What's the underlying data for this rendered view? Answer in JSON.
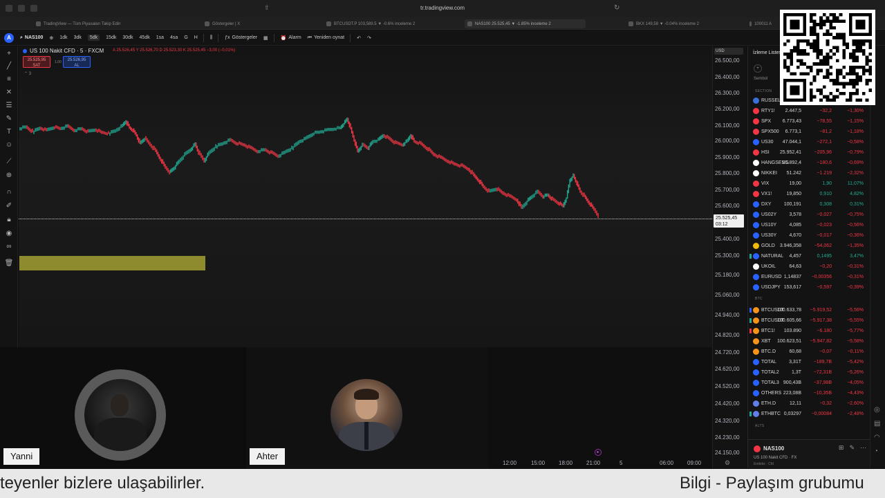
{
  "browser": {
    "url": "tr.tradingview.com",
    "tabs": [
      {
        "label": "TradingView — Tüm Piyasaları Takip Edin",
        "active": false
      },
      {
        "label": "Göstergeler | X",
        "active": false
      },
      {
        "label": "BTCUSDT.P 103,589.5 ▼ -0.6% inceleme 2",
        "active": false
      },
      {
        "label": "NAS100 25.525,45 ▼ -1.85% inceleme 2",
        "active": true
      },
      {
        "label": "BKX 149,58 ▼ -0.04% inceleme 2",
        "active": false
      },
      {
        "label": "100011 A",
        "active": false
      }
    ]
  },
  "toolbar": {
    "logo": "A",
    "symbol": "NAS100",
    "intervals": [
      "1dk",
      "3dk",
      "5dk",
      "15dk",
      "30dk",
      "45dk",
      "1sa",
      "4sa",
      "G",
      "H"
    ],
    "selected_interval": "5dk",
    "indicators_label": "Göstergeler",
    "alert_label": "Alarm",
    "replay_label": "Yeniden oynat"
  },
  "chart": {
    "legend_title": "US 100 Nakit CFD · 5 · FXCM",
    "legend_ohlc": "A 25.526,45  Y 25.526,70  D 25.523,30  K 25.525,45  −3,00 (−0,01%)",
    "sell_price": "25.525,95",
    "sell_label": "SAT",
    "buy_price": "25.526,95",
    "buy_label": "AL",
    "spread": "1,00",
    "legend_toggle": "⌃ 3",
    "currency": "USD",
    "current_price": "25.525,45",
    "countdown": "03:12",
    "price_ticks": [
      "26.500,00",
      "26.400,00",
      "26.300,00",
      "26.200,00",
      "26.100,00",
      "26.000,00",
      "25.900,00",
      "25.800,00",
      "25.700,00",
      "25.600,00",
      "25.400,00",
      "25.300,00",
      "25.180,00",
      "25.060,00",
      "24.940,00",
      "24.820,00",
      "24.720,00",
      "24.620,00",
      "24.520,00",
      "24.420,00",
      "24.320,00",
      "24.230,00",
      "24.150,00"
    ],
    "time_ticks": [
      "12:00",
      "15:00",
      "18:00",
      "21:00",
      "5",
      "06:00",
      "09:00"
    ],
    "series": [
      {
        "i": 0,
        "p": 26080
      },
      {
        "i": 10,
        "p": 26090
      },
      {
        "i": 20,
        "p": 26060
      },
      {
        "i": 30,
        "p": 26085
      },
      {
        "i": 40,
        "p": 26070
      },
      {
        "i": 50,
        "p": 26090
      },
      {
        "i": 60,
        "p": 26080
      },
      {
        "i": 70,
        "p": 26095
      },
      {
        "i": 80,
        "p": 26070
      },
      {
        "i": 90,
        "p": 26080
      },
      {
        "i": 100,
        "p": 26060
      },
      {
        "i": 110,
        "p": 26075
      },
      {
        "i": 120,
        "p": 26055
      },
      {
        "i": 130,
        "p": 26050
      },
      {
        "i": 140,
        "p": 26070
      },
      {
        "i": 150,
        "p": 26100
      },
      {
        "i": 155,
        "p": 26125
      },
      {
        "i": 160,
        "p": 26085
      },
      {
        "i": 165,
        "p": 26070
      },
      {
        "i": 170,
        "p": 26040
      },
      {
        "i": 175,
        "p": 25990
      },
      {
        "i": 182,
        "p": 26020
      },
      {
        "i": 190,
        "p": 25980
      },
      {
        "i": 198,
        "p": 25940
      },
      {
        "i": 205,
        "p": 25890
      },
      {
        "i": 212,
        "p": 25840
      },
      {
        "i": 218,
        "p": 25810
      },
      {
        "i": 225,
        "p": 25840
      },
      {
        "i": 232,
        "p": 25880
      },
      {
        "i": 240,
        "p": 25920
      },
      {
        "i": 248,
        "p": 25950
      },
      {
        "i": 255,
        "p": 25985
      },
      {
        "i": 260,
        "p": 25930
      },
      {
        "i": 268,
        "p": 25880
      },
      {
        "i": 275,
        "p": 25930
      },
      {
        "i": 285,
        "p": 25970
      },
      {
        "i": 295,
        "p": 25990
      },
      {
        "i": 305,
        "p": 26010
      },
      {
        "i": 315,
        "p": 25990
      },
      {
        "i": 325,
        "p": 25980
      },
      {
        "i": 335,
        "p": 25960
      },
      {
        "i": 345,
        "p": 25940
      },
      {
        "i": 355,
        "p": 25950
      },
      {
        "i": 365,
        "p": 25930
      },
      {
        "i": 375,
        "p": 25910
      },
      {
        "i": 385,
        "p": 25935
      },
      {
        "i": 395,
        "p": 25960
      },
      {
        "i": 405,
        "p": 26000
      },
      {
        "i": 415,
        "p": 26020
      },
      {
        "i": 425,
        "p": 26050
      },
      {
        "i": 435,
        "p": 26060
      },
      {
        "i": 445,
        "p": 26070
      },
      {
        "i": 455,
        "p": 26080
      },
      {
        "i": 465,
        "p": 26085
      },
      {
        "i": 470,
        "p": 26110
      },
      {
        "i": 475,
        "p": 26140
      },
      {
        "i": 480,
        "p": 26080
      },
      {
        "i": 485,
        "p": 26010
      },
      {
        "i": 490,
        "p": 25940
      },
      {
        "i": 497,
        "p": 25980
      },
      {
        "i": 505,
        "p": 25960
      },
      {
        "i": 512,
        "p": 26000
      },
      {
        "i": 520,
        "p": 26010
      },
      {
        "i": 527,
        "p": 26040
      },
      {
        "i": 535,
        "p": 26020
      },
      {
        "i": 545,
        "p": 25990
      },
      {
        "i": 555,
        "p": 25980
      },
      {
        "i": 562,
        "p": 26005
      },
      {
        "i": 567,
        "p": 26040
      },
      {
        "i": 572,
        "p": 26000
      },
      {
        "i": 580,
        "p": 25990
      },
      {
        "i": 590,
        "p": 25960
      },
      {
        "i": 600,
        "p": 25920
      },
      {
        "i": 610,
        "p": 25900
      },
      {
        "i": 620,
        "p": 25880
      },
      {
        "i": 630,
        "p": 25860
      },
      {
        "i": 640,
        "p": 25850
      },
      {
        "i": 650,
        "p": 25830
      },
      {
        "i": 658,
        "p": 25790
      },
      {
        "i": 665,
        "p": 25760
      },
      {
        "i": 672,
        "p": 25720
      },
      {
        "i": 680,
        "p": 25690
      },
      {
        "i": 690,
        "p": 25710
      },
      {
        "i": 700,
        "p": 25680
      },
      {
        "i": 710,
        "p": 25660
      },
      {
        "i": 720,
        "p": 25640
      },
      {
        "i": 727,
        "p": 25590
      },
      {
        "i": 735,
        "p": 25630
      },
      {
        "i": 742,
        "p": 25660
      },
      {
        "i": 750,
        "p": 25690
      },
      {
        "i": 758,
        "p": 25660
      },
      {
        "i": 765,
        "p": 25670
      },
      {
        "i": 772,
        "p": 25640
      },
      {
        "i": 780,
        "p": 25620
      },
      {
        "i": 787,
        "p": 25600
      },
      {
        "i": 792,
        "p": 25650
      },
      {
        "i": 797,
        "p": 25760
      },
      {
        "i": 802,
        "p": 25790
      },
      {
        "i": 807,
        "p": 25740
      },
      {
        "i": 812,
        "p": 25690
      },
      {
        "i": 818,
        "p": 25660
      },
      {
        "i": 825,
        "p": 25620
      },
      {
        "i": 832,
        "p": 25580
      },
      {
        "i": 838,
        "p": 25540
      }
    ]
  },
  "video": {
    "left_name": "Yanni",
    "right_name": "Ahter"
  },
  "watchlist": {
    "title": "İzleme Listesi",
    "column_symbol": "Sembol",
    "section_labels": [
      "SECTION",
      "BTC",
      "ALTS"
    ],
    "rows": [
      {
        "sym": "RUSSELL",
        "last": "",
        "chg": "",
        "pct": "",
        "ic": "#3a6fd8",
        "flag": ""
      },
      {
        "sym": "RTY1!",
        "last": "2.447,5",
        "chg": "−32,2",
        "pct": "−1,30%",
        "ic": "#f23645",
        "flag": ""
      },
      {
        "sym": "SPX",
        "last": "6.773,43",
        "chg": "−78,55",
        "pct": "−1,15%",
        "ic": "#f23645",
        "flag": ""
      },
      {
        "sym": "SPX500",
        "last": "6.773,1",
        "chg": "−81,2",
        "pct": "−1,18%",
        "ic": "#f23645",
        "flag": ""
      },
      {
        "sym": "US30",
        "last": "47.044,1",
        "chg": "−272,1",
        "pct": "−0,58%",
        "ic": "#2962ff",
        "flag": ""
      },
      {
        "sym": "HSI",
        "last": "25.952,41",
        "chg": "−205,96",
        "pct": "−0,79%",
        "ic": "#f23645",
        "flag": ""
      },
      {
        "sym": "HANGSENG",
        "last": "25.892,4",
        "chg": "−180,6",
        "pct": "−0,69%",
        "ic": "#ffffff",
        "flag": ""
      },
      {
        "sym": "NIKKEI",
        "last": "51.242",
        "chg": "−1.219",
        "pct": "−2,32%",
        "ic": "#ffffff",
        "flag": ""
      },
      {
        "sym": "VIX",
        "last": "19,00",
        "chg": "1,90",
        "pct": "11,07%",
        "ic": "#f23645",
        "flag": ""
      },
      {
        "sym": "VX1!",
        "last": "19,850",
        "chg": "0,910",
        "pct": "4,82%",
        "ic": "#f23645",
        "flag": ""
      },
      {
        "sym": "DXY",
        "last": "100,191",
        "chg": "0,308",
        "pct": "0,31%",
        "ic": "#2962ff",
        "flag": ""
      },
      {
        "sym": "US02Y",
        "last": "3,578",
        "chg": "−0,027",
        "pct": "−0,75%",
        "ic": "#2962ff",
        "flag": ""
      },
      {
        "sym": "US10Y",
        "last": "4,085",
        "chg": "−0,023",
        "pct": "−0,56%",
        "ic": "#2962ff",
        "flag": ""
      },
      {
        "sym": "US30Y",
        "last": "4,670",
        "chg": "−0,017",
        "pct": "−0,36%",
        "ic": "#2962ff",
        "flag": ""
      },
      {
        "sym": "GOLD",
        "last": "3.946,358",
        "chg": "−54,062",
        "pct": "−1,35%",
        "ic": "#f0b90b",
        "flag": ""
      },
      {
        "sym": "NATURAL",
        "last": "4,457",
        "chg": "0,1495",
        "pct": "3,47%",
        "ic": "#2962ff",
        "flag": "#22ab94"
      },
      {
        "sym": "UKOIL",
        "last": "64,63",
        "chg": "−0,20",
        "pct": "−0,31%",
        "ic": "#ffffff",
        "flag": ""
      },
      {
        "sym": "EURUSD",
        "last": "1,14837",
        "chg": "−0,00356",
        "pct": "−0,31%",
        "ic": "#2962ff",
        "flag": ""
      },
      {
        "sym": "USDJPY",
        "last": "153,617",
        "chg": "−0,597",
        "pct": "−0,39%",
        "ic": "#2962ff",
        "flag": ""
      },
      {
        "sym": "BTCUSDT",
        "last": "100.633,78",
        "chg": "−5.919,52",
        "pct": "−5,56%",
        "ic": "#f7931a",
        "flag": "#2962ff"
      },
      {
        "sym": "BTCUSDT",
        "last": "100.605,66",
        "chg": "−5.917,38",
        "pct": "−5,55%",
        "ic": "#f7931a",
        "flag": "#22ab94"
      },
      {
        "sym": "BTC1!",
        "last": "103.890",
        "chg": "−6.180",
        "pct": "−5,77%",
        "ic": "#f7931a",
        "flag": "#f23645"
      },
      {
        "sym": "XBT",
        "last": "100.623,51",
        "chg": "−5.947,82",
        "pct": "−5,58%",
        "ic": "#f7931a",
        "flag": ""
      },
      {
        "sym": "BTC.D",
        "last": "60,68",
        "chg": "−0,07",
        "pct": "−0,11%",
        "ic": "#f7931a",
        "flag": ""
      },
      {
        "sym": "TOTAL",
        "last": "3,31T",
        "chg": "−189,7B",
        "pct": "−5,42%",
        "ic": "#2962ff",
        "flag": ""
      },
      {
        "sym": "TOTAL2",
        "last": "1,3T",
        "chg": "−72,31B",
        "pct": "−5,26%",
        "ic": "#2962ff",
        "flag": ""
      },
      {
        "sym": "TOTAL3",
        "last": "900,43B",
        "chg": "−37,98B",
        "pct": "−4,05%",
        "ic": "#2962ff",
        "flag": ""
      },
      {
        "sym": "OTHERS",
        "last": "223,08B",
        "chg": "−10,35B",
        "pct": "−4,43%",
        "ic": "#2962ff",
        "flag": ""
      },
      {
        "sym": "ETH.D",
        "last": "12,11",
        "chg": "−0,32",
        "pct": "−2,60%",
        "ic": "#627eea",
        "flag": ""
      },
      {
        "sym": "ETHBTC",
        "last": "0,03297",
        "chg": "−0,00084",
        "pct": "−2,48%",
        "ic": "#627eea",
        "flag": "#22ab94"
      }
    ],
    "bottom_symbol": "NAS100",
    "bottom_desc": "US 100 Nakit CFD · FX",
    "bottom_sub": "Endeks · Cfd"
  },
  "ticker": {
    "left_text": "teyenler bizlere ulaşabilirler.",
    "right_text": "Bilgi - Paylaşım grubumu"
  },
  "colors": {
    "up": "#22ab94",
    "down": "#f23645",
    "accent": "#2962ff"
  }
}
